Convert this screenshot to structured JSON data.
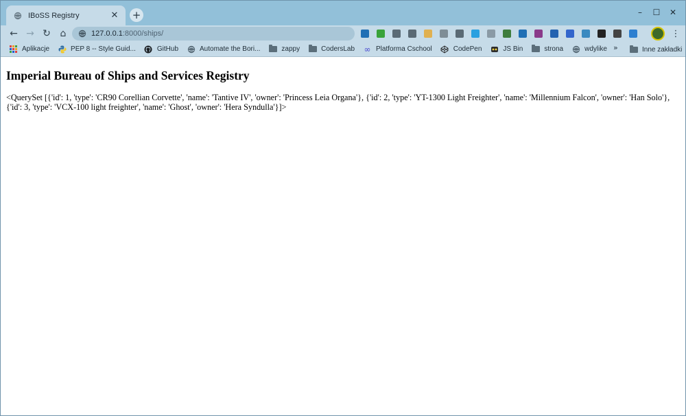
{
  "tab": {
    "title": "IBoSS Registry",
    "close_glyph": "✕"
  },
  "new_tab_glyph": "+",
  "window_controls": {
    "minimize": "–",
    "maximize": "☐",
    "close": "✕"
  },
  "toolbar": {
    "back_glyph": "←",
    "forward_glyph": "→",
    "reload_glyph": "↻",
    "home_glyph": "⌂",
    "url_host": "127.0.0.1",
    "url_path": ":8000/ships/",
    "menu_glyph": "⋮"
  },
  "extensions": [
    {
      "icon": "trello-icon",
      "color": "#1f6fb5"
    },
    {
      "icon": "refresh-green-icon",
      "color": "#3aa33a"
    },
    {
      "icon": "kanban-icon",
      "color": "#5a6a75"
    },
    {
      "icon": "board-icon",
      "color": "#5a6a75"
    },
    {
      "icon": "stripe-icon",
      "color": "#e0b050"
    },
    {
      "icon": "owl-icon",
      "color": "#7e8d96"
    },
    {
      "icon": "pocket-icon",
      "color": "#5a6a75"
    },
    {
      "icon": "plus-circle-icon",
      "color": "#2aa0e0"
    },
    {
      "icon": "dot-circle-icon",
      "color": "#8a9aa5"
    },
    {
      "icon": "leaf-icon",
      "color": "#3e7d3e"
    },
    {
      "icon": "trello-icon-2",
      "color": "#1f6fb5"
    },
    {
      "icon": "chart-icon",
      "color": "#8a3a8a"
    },
    {
      "icon": "box-icon",
      "color": "#2262b0"
    },
    {
      "icon": "globe-icon",
      "color": "#3366cc"
    },
    {
      "icon": "grid-icon",
      "color": "#3a8ac0"
    },
    {
      "icon": "mask-icon",
      "color": "#222222"
    },
    {
      "icon": "image-icon",
      "color": "#444444"
    },
    {
      "icon": "feather-icon",
      "color": "#2d7fd0"
    }
  ],
  "bookmarks": [
    {
      "label": "Aplikacje",
      "icon": "apps-icon"
    },
    {
      "label": "PEP 8 -- Style Guid...",
      "icon": "python-icon"
    },
    {
      "label": "GitHub",
      "icon": "github-icon"
    },
    {
      "label": "Automate the Bori...",
      "icon": "globe-icon"
    },
    {
      "label": "zappy",
      "icon": "folder-icon"
    },
    {
      "label": "CodersLab",
      "icon": "folder-icon"
    },
    {
      "label": "Platforma Cschool",
      "icon": "infinity-icon"
    },
    {
      "label": "CodePen",
      "icon": "codepen-icon"
    },
    {
      "label": "JS Bin",
      "icon": "jsbin-icon"
    },
    {
      "label": "strona",
      "icon": "folder-icon"
    },
    {
      "label": "wdylike",
      "icon": "globe-icon"
    }
  ],
  "bookmarks_more_glyph": "»",
  "bookmarks_other": "Inne zakładki",
  "page": {
    "heading": "Imperial Bureau of Ships and Services Registry",
    "body": "<QuerySet [{'id': 1, 'type': 'CR90 Corellian Corvette', 'name': 'Tantive IV', 'owner': 'Princess Leia Organa'}, {'id': 2, 'type': 'YT-1300 Light Freighter', 'name': 'Millennium Falcon', 'owner': 'Han Solo'}, {'id': 3, 'type': 'VCX-100 light freighter', 'name': 'Ghost', 'owner': 'Hera Syndulla'}]>"
  }
}
